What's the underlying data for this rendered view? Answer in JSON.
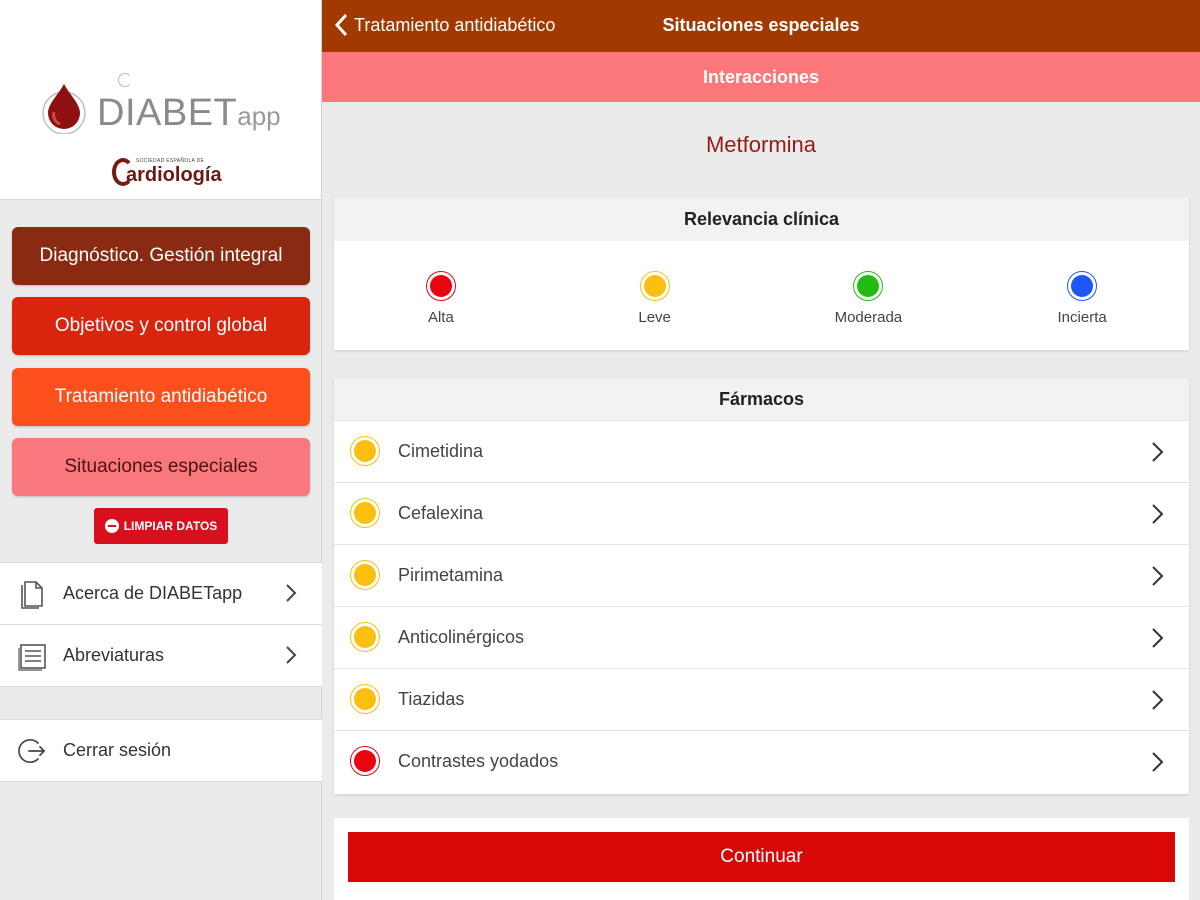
{
  "header": {
    "back_label": "Tratamiento antidiabético",
    "title": "Situaciones especiales",
    "section": "Interacciones"
  },
  "sidebar": {
    "brand_main": "DIABET",
    "brand_suffix": "app",
    "society_small": "SOCIEDAD ESPAÑOLA DE",
    "society_name": "ardiología",
    "nav": [
      {
        "label": "Diagnóstico. Gestión integral"
      },
      {
        "label": "Objetivos y control global"
      },
      {
        "label": "Tratamiento antidiabético"
      },
      {
        "label": "Situaciones especiales"
      }
    ],
    "clear_label": "LIMPIAR DATOS",
    "links": [
      {
        "label": "Acerca de DIABETapp",
        "icon": "document-icon"
      },
      {
        "label": "Abreviaturas",
        "icon": "list-icon"
      }
    ],
    "logout_label": "Cerrar sesión"
  },
  "main": {
    "drug_name": "Metformina",
    "relevance": {
      "title": "Relevancia clínica",
      "items": [
        {
          "label": "Alta",
          "color": "#e8050f"
        },
        {
          "label": "Leve",
          "color": "#fcbf0f"
        },
        {
          "label": "Moderada",
          "color": "#22bb11"
        },
        {
          "label": "Incierta",
          "color": "#1e55f5"
        }
      ]
    },
    "drugs": {
      "title": "Fármacos",
      "items": [
        {
          "label": "Cimetidina",
          "color": "#fcbf0f"
        },
        {
          "label": "Cefalexina",
          "color": "#fcbf0f"
        },
        {
          "label": "Pirimetamina",
          "color": "#fcbf0f"
        },
        {
          "label": "Anticolinérgicos",
          "color": "#fcbf0f"
        },
        {
          "label": "Tiazidas",
          "color": "#fcbf0f"
        },
        {
          "label": "Contrastes yodados",
          "color": "#e8050f"
        }
      ]
    },
    "continue_label": "Continuar"
  }
}
